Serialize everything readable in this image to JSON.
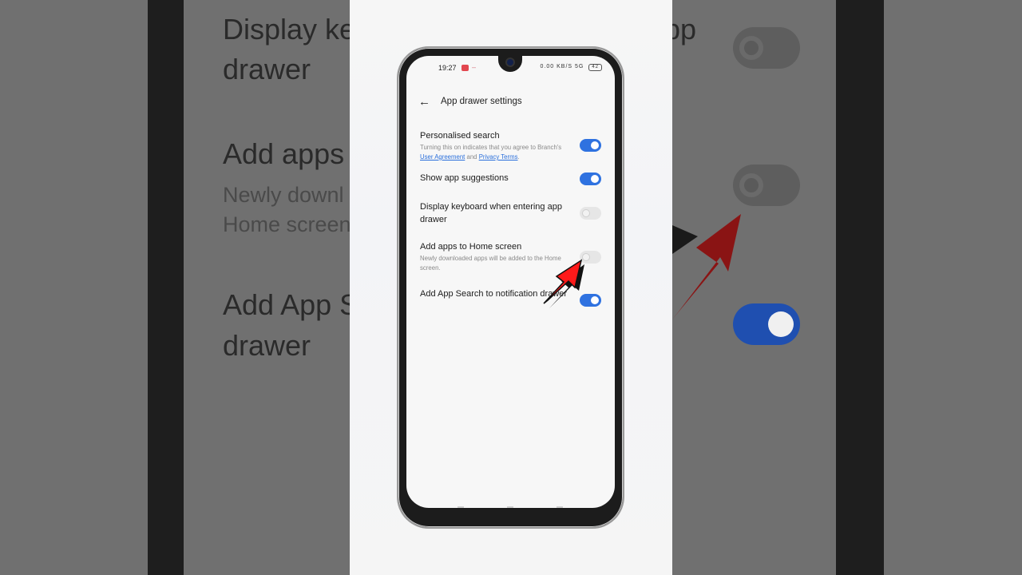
{
  "status_bar": {
    "time": "19:27",
    "indicators": "0.00 KB/S",
    "signal": "5G",
    "battery": "42"
  },
  "header": {
    "back_icon": "←",
    "title": "App drawer settings"
  },
  "settings": [
    {
      "title": "Personalised search",
      "desc_prefix": "Turning this on indicates that you agree to Branch's ",
      "link1": "User Agreement",
      "desc_mid": " and ",
      "link2": "Privacy Terms",
      "desc_suffix": ".",
      "enabled": true
    },
    {
      "title": "Show app suggestions",
      "enabled": true
    },
    {
      "title": "Display keyboard when entering app drawer",
      "enabled": false
    },
    {
      "title": "Add apps to Home screen",
      "desc": "Newly downloaded apps will be added to the Home screen.",
      "enabled": false
    },
    {
      "title": "Add App Search to notification drawer",
      "enabled": true
    }
  ],
  "background_zoom": {
    "line1": "Display ke",
    "line1_right": "pp",
    "line2": "drawer",
    "line3": "Add apps",
    "sub1": "Newly downl",
    "sub2": "Home screen",
    "line4": "Add App S",
    "line5": "drawer"
  },
  "colors": {
    "accent": "#2f72e0",
    "annotation_arrow": "#ff0000"
  }
}
